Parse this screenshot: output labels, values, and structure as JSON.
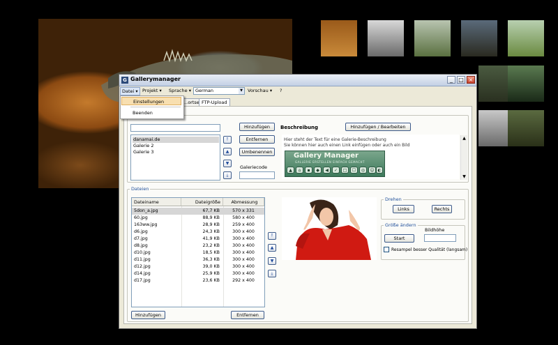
{
  "window": {
    "title": "Gallerymanager",
    "icon_name": "gallerymanager-app-icon",
    "controls": [
      "_",
      "□",
      "×"
    ]
  },
  "menubar": {
    "items": [
      "Datei",
      "Projekt",
      "Sprache",
      "Vorschau",
      "?"
    ],
    "language_value": "German"
  },
  "file_menu": {
    "items": [
      "Einstellungen",
      "Beenden"
    ]
  },
  "tabs": [
    "...ortseite",
    "FTP-Upload"
  ],
  "galleries": {
    "search_value": "",
    "items": [
      "danamai.de",
      "Galerie 2",
      "Galerie 3"
    ],
    "selected_index": 0,
    "buttons": {
      "add": "Hinzufügen",
      "remove": "Entfernen",
      "rename": "Umbenennen"
    },
    "code_label": "Galeriecode",
    "code_value": ""
  },
  "description": {
    "label": "Beschreibung",
    "edit_button": "Hinzufügen / Bearbeiten",
    "text_line1": "Hier steht der Text für eine Galerie-Beschreibung",
    "text_line2": "Sie können hier auch einen Link einfügen oder auch ein Bild",
    "banner_title": "Gallery Manager",
    "banner_subtitle": "GALLERIE ERSTELLEN  EINFACH GEMACHT",
    "banner_icons": [
      "▲",
      "⌂",
      "▪",
      "◆",
      "◀",
      "✓",
      "□",
      "☐",
      "◎",
      "☺",
      "◐"
    ]
  },
  "files": {
    "group_label": "Dateien",
    "columns": [
      "Dateiname",
      "Dateigröße",
      "Abmessung"
    ],
    "rows": [
      [
        "5don_a.jpg",
        "67,7 KB",
        "570 x 331"
      ],
      [
        "60.jpg",
        "88,9 KB",
        "580 x 400"
      ],
      [
        "163ww.jpg",
        "28,9 KB",
        "259 x 400"
      ],
      [
        "d6.jpg",
        "24,3 KB",
        "300 x 400"
      ],
      [
        "d7.jpg",
        "41,9 KB",
        "300 x 400"
      ],
      [
        "d8.jpg",
        "23,2 KB",
        "300 x 400"
      ],
      [
        "d10.jpg",
        "18,5 KB",
        "300 x 400"
      ],
      [
        "d11.jpg",
        "36,3 KB",
        "300 x 400"
      ],
      [
        "d12.jpg",
        "39,0 KB",
        "300 x 400"
      ],
      [
        "d14.jpg",
        "25,9 KB",
        "300 x 400"
      ],
      [
        "d17.jpg",
        "23,6 KB",
        "292 x 400"
      ]
    ],
    "selected_index": 0,
    "buttons": {
      "add": "Hinzufügen",
      "remove": "Entfernen"
    }
  },
  "rotate": {
    "label": "Drehen",
    "left": "Links",
    "right": "Rechts"
  },
  "resize": {
    "label": "Größe ändern",
    "height_label": "Bildhöhe",
    "height_value": "",
    "start": "Start",
    "resample_label": "Resampel besser Qualität (langsam)",
    "resample_checked": false
  },
  "colors": {
    "accent": "#1f4f9a",
    "selection": "#d6d6d6",
    "menu_highlight": "#f8dfb0"
  }
}
